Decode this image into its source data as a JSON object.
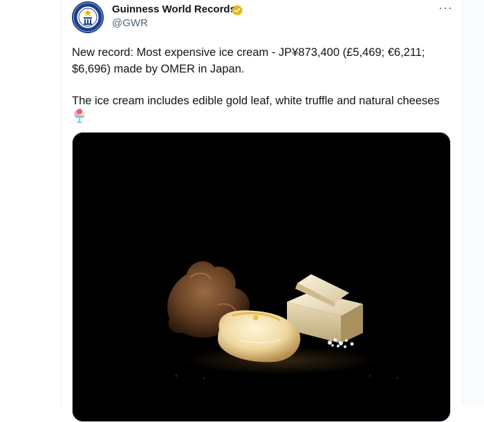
{
  "author": {
    "name": "Guinness World Records",
    "handle": "@GWR",
    "verified_color": "#e2b719",
    "avatar_ring_color": "#1c3f8c"
  },
  "avatar_logo_text": "GUINNESS WORLD RECORDS",
  "tweet": {
    "paragraph_1": "New record: Most expensive ice cream - JP¥873,400 (£5,469; €6,211; $6,696) made by OMER in Japan.",
    "paragraph_2": "The ice cream includes edible gold leaf, white truffle and natural cheeses",
    "emoji_icon": "ice-cream-sundae-icon"
  },
  "menu": {
    "more_label": "···"
  },
  "media": {
    "description_icon": "ice-cream-photo",
    "background": "#000000"
  }
}
